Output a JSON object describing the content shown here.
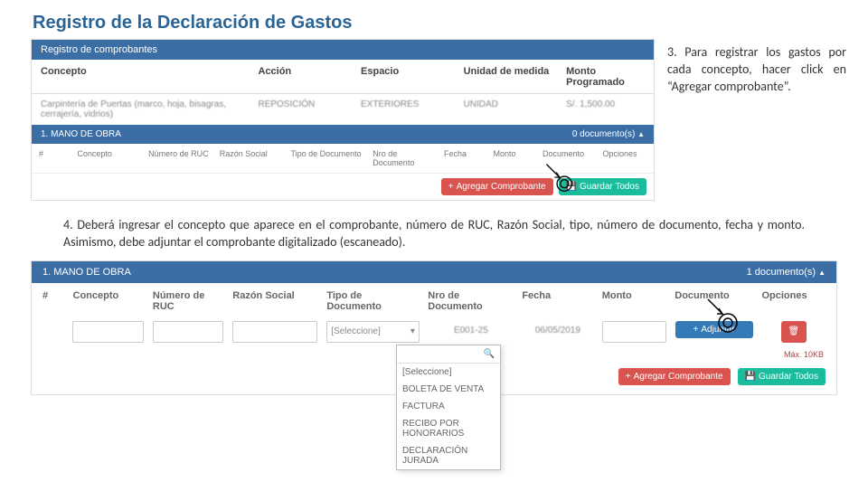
{
  "page_title": "Registro de la Declaración de Gastos",
  "callout_3": "3. Para registrar los gastos por cada concepto, hacer click en “Agregar comprobante”.",
  "step4": "4. Deberá ingresar el concepto que aparece en el comprobante, número de RUC, Razón Social, tipo, número de documento, fecha y monto.  Asimismo, debe adjuntar el comprobante digitalizado (escaneado).",
  "panel1": {
    "bar_title": "Registro de comprobantes",
    "headers": {
      "c1": "Concepto",
      "c2": "Acción",
      "c3": "Espacio",
      "c4": "Unidad de medida",
      "c5": "Monto Programado"
    },
    "row": {
      "c1": "Carpintería de Puertas (marco, hoja, bisagras, cerrajería, vidrios)",
      "c2": "REPOSICIÓN",
      "c3": "EXTERIORES",
      "c4": "UNIDAD",
      "c5": "S/. 1,500.00"
    },
    "mano_bar": "1. MANO DE OBRA",
    "docs_label": "0 documento(s)",
    "sub": {
      "s1": "#",
      "s2": "Concepto",
      "s3": "Número de RUC",
      "s4": "Razón Social",
      "s5": "Tipo de Documento",
      "s6": "Nro de Documento",
      "s7": "Fecha",
      "s8": "Monto",
      "s9": "Documento",
      "s10": "Opciones"
    },
    "btn_add": "Agregar Comprobante",
    "btn_save": "Guardar Todos"
  },
  "panel2": {
    "mano_bar": "1. MANO DE OBRA",
    "docs_label": "1 documento(s)",
    "sub": {
      "s1": "#",
      "s2": "Concepto",
      "s3": "Número de RUC",
      "s4": "Razón Social",
      "s5": "Tipo de Documento",
      "s6": "Nro de Documento",
      "s7": "Fecha",
      "s8": "Monto",
      "s9": "Documento",
      "s10": "Opciones"
    },
    "select_placeholder": "[Seleccione]",
    "doc_value": "E001-25",
    "date_value": "06/05/2019",
    "dropdown": [
      "[Seleccione]",
      "BOLETA DE VENTA",
      "FACTURA",
      "RECIBO POR HONORARIOS",
      "DECLARACIÓN JURADA"
    ],
    "btn_adjuntar": "Adjuntar",
    "note_max": "Máx. 10KB",
    "btn_add": "Agregar Comprobante",
    "btn_save": "Guardar Todos"
  }
}
